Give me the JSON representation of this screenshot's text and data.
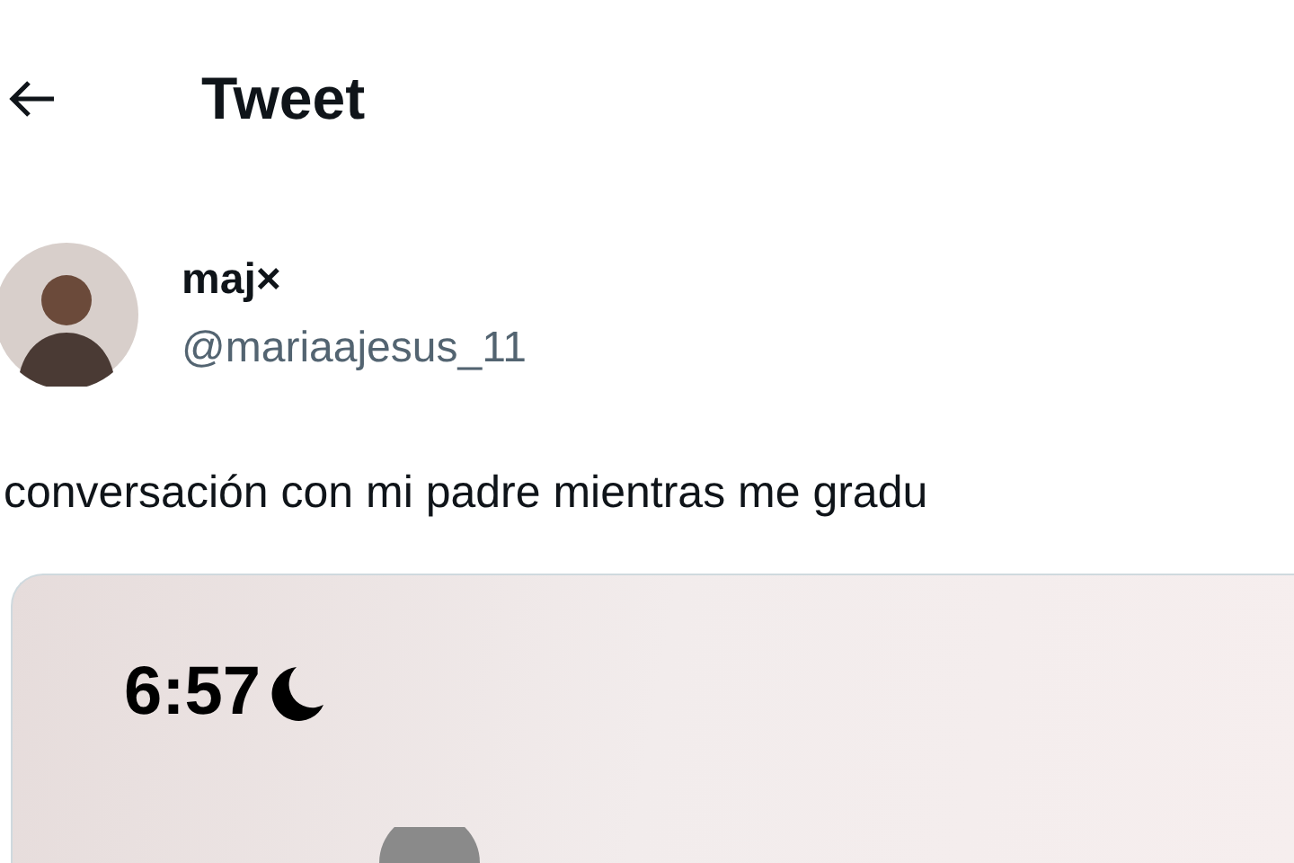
{
  "header": {
    "title": "Tweet"
  },
  "author": {
    "name": "maj×",
    "handle": "@mariaajesus_11"
  },
  "tweet": {
    "text": "conversación con mi padre mientras me gradu"
  },
  "media": {
    "kind": "screenshot",
    "time": "6:57"
  }
}
